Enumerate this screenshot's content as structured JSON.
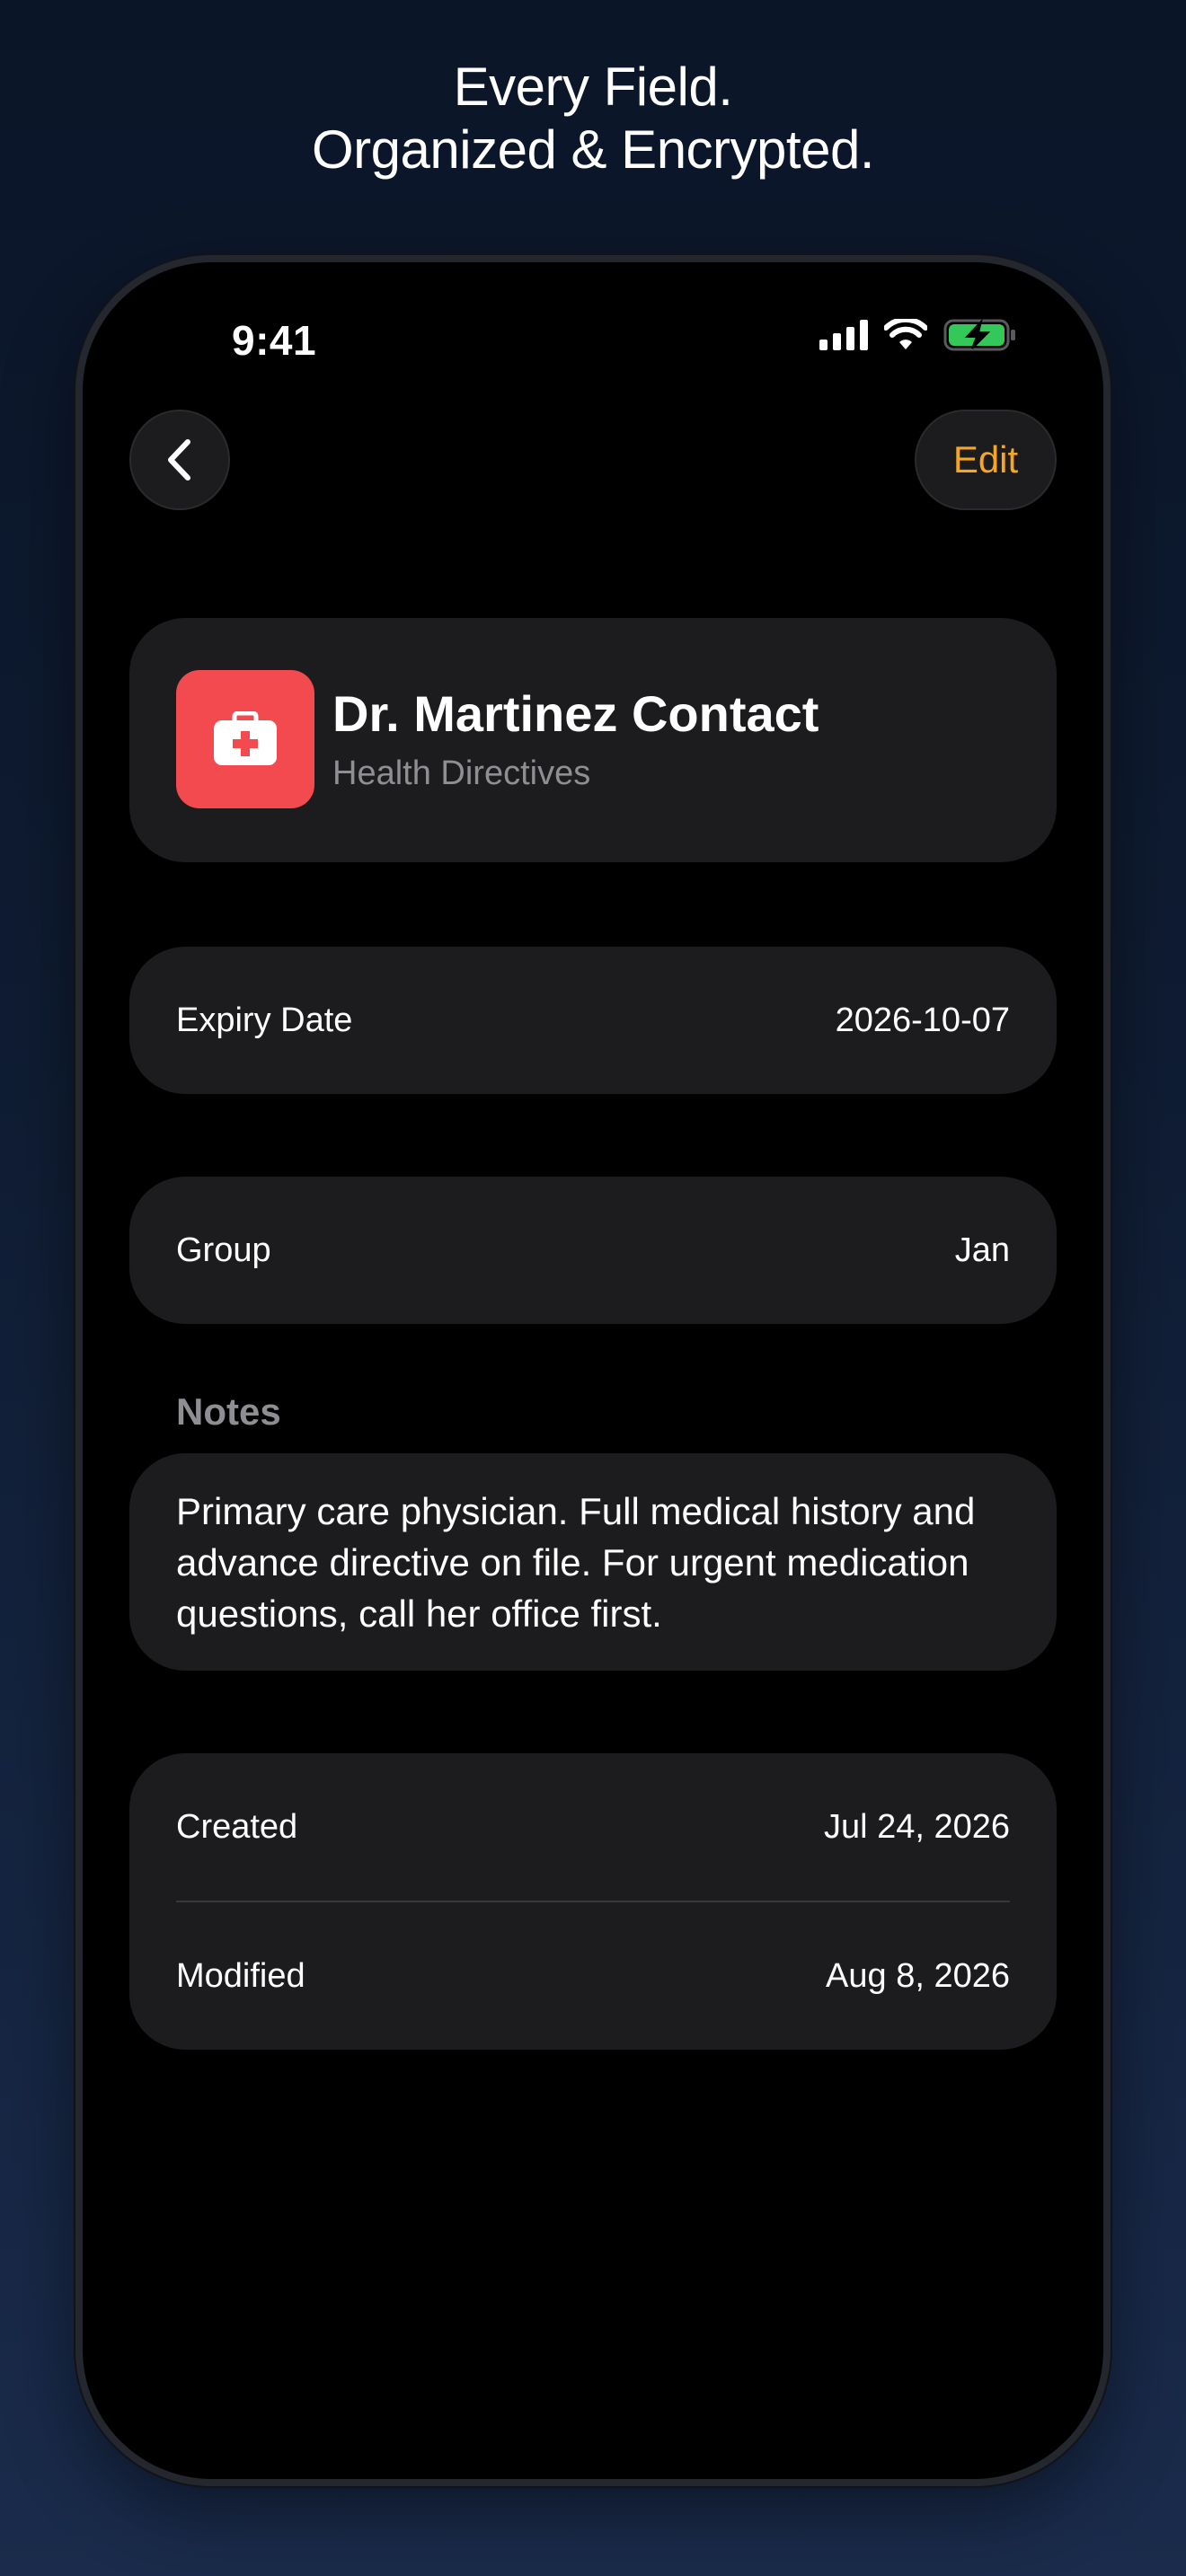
{
  "headline": {
    "line1": "Every Field.",
    "line2": "Organized & Encrypted."
  },
  "status_bar": {
    "time": "9:41",
    "icons": [
      "signal-icon",
      "wifi-icon",
      "battery-charging-icon"
    ],
    "battery_color": "#34c759"
  },
  "nav": {
    "back_icon": "chevron-left-icon",
    "edit_label": "Edit",
    "accent_color": "#f5a623"
  },
  "record": {
    "title": "Dr. Martinez Contact",
    "category": "Health Directives",
    "icon": "medical-kit-icon",
    "icon_color": "#f24a4f"
  },
  "fields": {
    "expiry": {
      "label": "Expiry Date",
      "value": "2026-10-07"
    },
    "group": {
      "label": "Group",
      "value": "Jan"
    }
  },
  "notes": {
    "label": "Notes",
    "text": "Primary care physician. Full medical history and advance directive on file. For urgent medication questions, call her office first."
  },
  "dates": {
    "created": {
      "label": "Created",
      "value": "Jul 24, 2026"
    },
    "modified": {
      "label": "Modified",
      "value": "Aug 8, 2026"
    }
  }
}
